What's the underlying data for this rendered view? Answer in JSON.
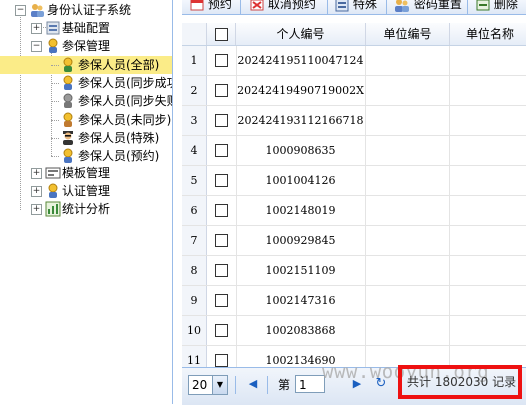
{
  "tree": {
    "root": "身份认证子系统",
    "items": [
      {
        "label": "基础配置"
      },
      {
        "label": "参保管理"
      },
      {
        "label": "参保人员(全部)"
      },
      {
        "label": "参保人员(同步成功)"
      },
      {
        "label": "参保人员(同步失败)"
      },
      {
        "label": "参保人员(未同步)"
      },
      {
        "label": "参保人员(特殊)"
      },
      {
        "label": "参保人员(预约)"
      },
      {
        "label": "模板管理"
      },
      {
        "label": "认证管理"
      },
      {
        "label": "统计分析"
      }
    ]
  },
  "toolbar": {
    "items": [
      "预约",
      "取消预约",
      "特殊",
      "密码重置",
      "删除"
    ]
  },
  "grid": {
    "columns": [
      "个人编号",
      "单位编号",
      "单位名称"
    ],
    "rows": [
      {
        "n": "1",
        "id": "20242419511004712​4"
      },
      {
        "n": "2",
        "id": "20242419490719002X"
      },
      {
        "n": "3",
        "id": "202424193112166718"
      },
      {
        "n": "4",
        "id": "1000908635"
      },
      {
        "n": "5",
        "id": "1001004126"
      },
      {
        "n": "6",
        "id": "1002148019"
      },
      {
        "n": "7",
        "id": "1000929845"
      },
      {
        "n": "8",
        "id": "1002151109"
      },
      {
        "n": "9",
        "id": "1002147316"
      },
      {
        "n": "10",
        "id": "1002083868"
      },
      {
        "n": "11",
        "id": "1002134690"
      }
    ]
  },
  "pager": {
    "page_size": "20",
    "page_label": "第",
    "page_value": "1",
    "total_text": "共计 1802030 记录"
  },
  "watermark": "www.wooyun.org"
}
